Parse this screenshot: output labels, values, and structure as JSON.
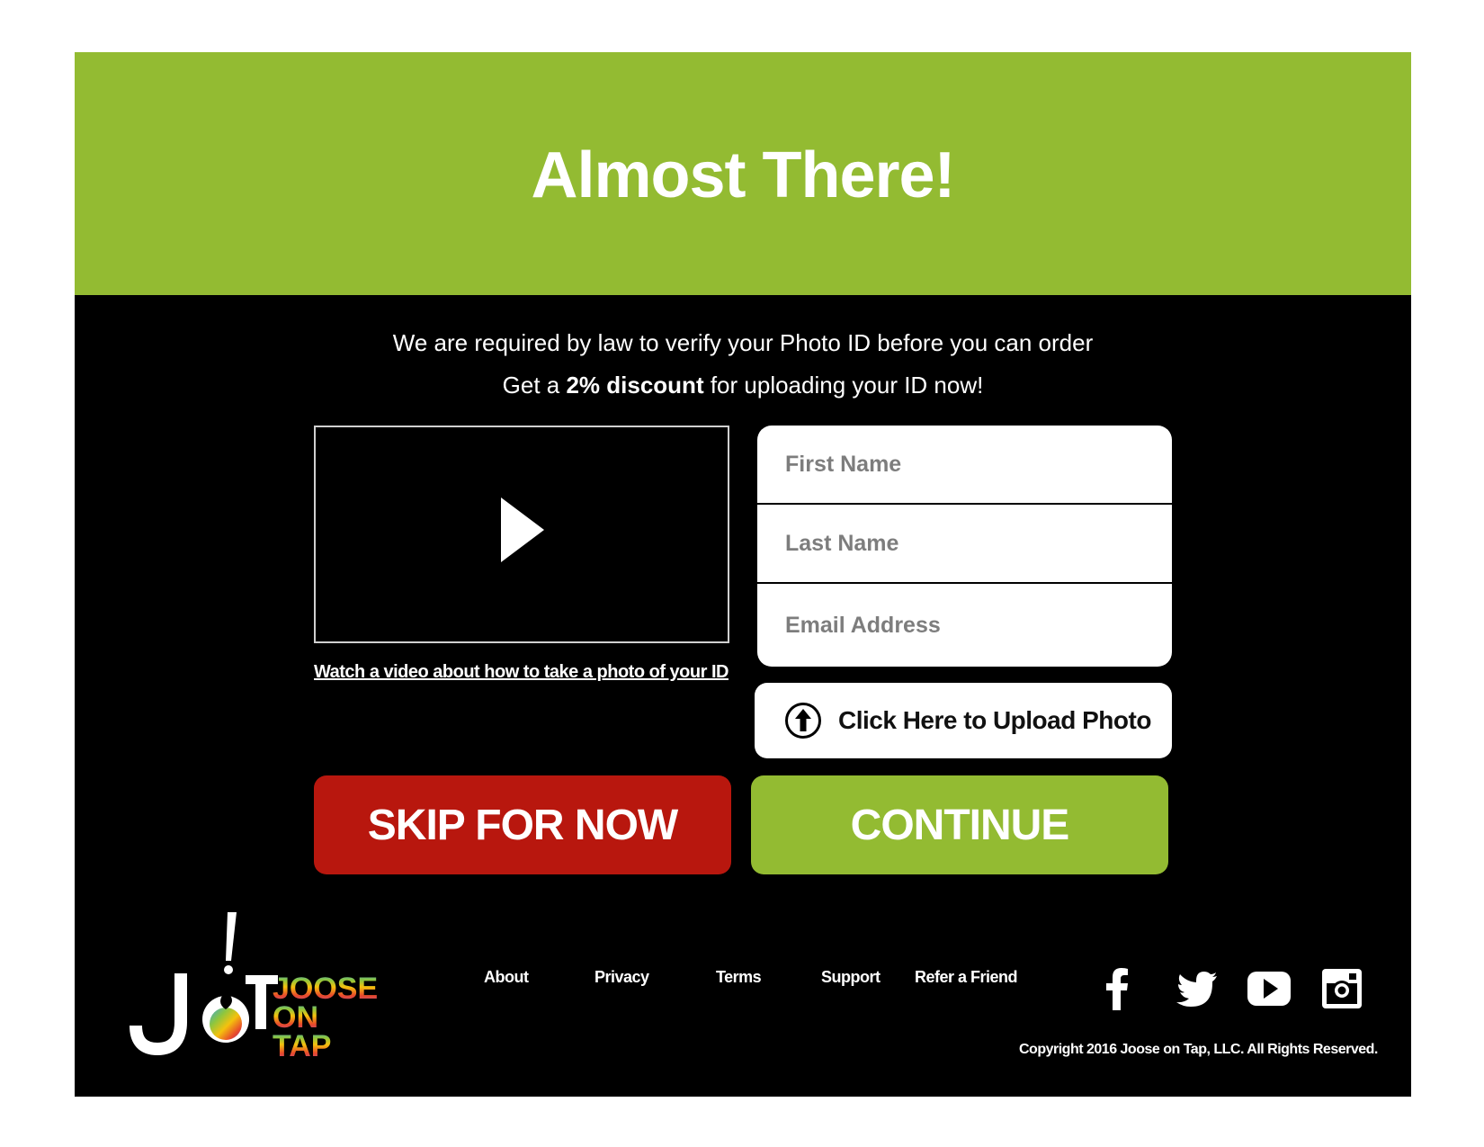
{
  "header": {
    "title": "Almost There!"
  },
  "intro": {
    "line1": "We are required by law to verify your Photo ID before you can order",
    "line2_prefix": "Get a ",
    "line2_bold": "2% discount",
    "line2_suffix": " for uploading your ID now!"
  },
  "video": {
    "link_text": "Watch a video about how to take a photo of your ID",
    "icon": "play-icon"
  },
  "form": {
    "first_name": {
      "placeholder": "First Name",
      "value": ""
    },
    "last_name": {
      "placeholder": "Last Name",
      "value": ""
    },
    "email": {
      "placeholder": "Email Address",
      "value": ""
    }
  },
  "upload": {
    "label": "Click Here to Upload Photo",
    "icon": "upload-arrow-icon"
  },
  "buttons": {
    "skip": "SKIP FOR NOW",
    "continue": "CONTINUE"
  },
  "footer": {
    "logo_text": [
      "JOOSE",
      "ON",
      "TAP"
    ],
    "nav": [
      "About",
      "Privacy",
      "Terms",
      "Support",
      "Refer a Friend"
    ],
    "social": [
      "facebook-icon",
      "twitter-icon",
      "youtube-icon",
      "instagram-icon"
    ],
    "copyright": "Copyright 2016 Joose on Tap, LLC.  All Rights Reserved."
  },
  "colors": {
    "green": "#93bb32",
    "red": "#b8170e",
    "black": "#000000",
    "white": "#ffffff"
  }
}
